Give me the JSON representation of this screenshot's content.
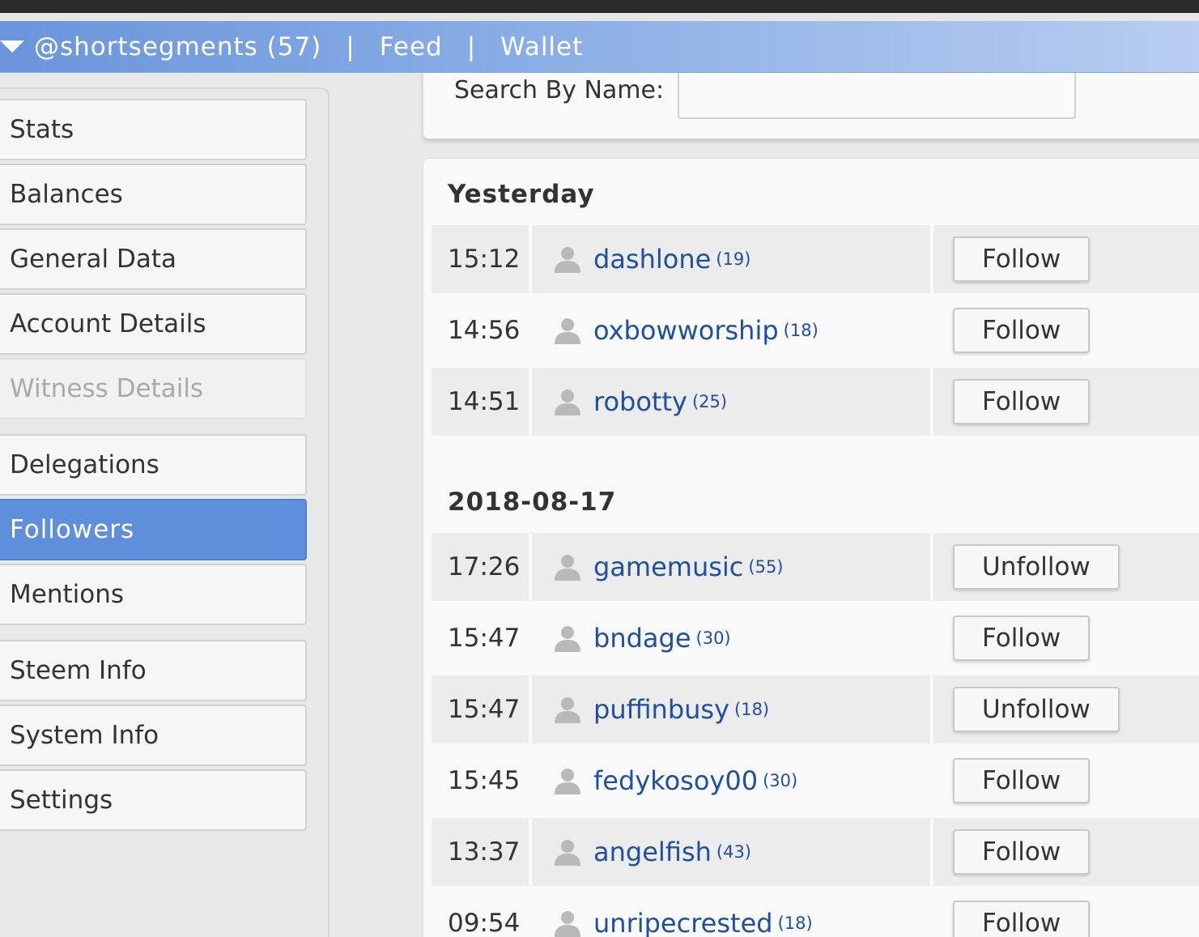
{
  "header": {
    "account": "@shortsegments (57)",
    "separator": "|",
    "feed": "Feed",
    "wallet": "Wallet"
  },
  "sidebar": {
    "items": [
      {
        "label": "Stats",
        "state": "normal"
      },
      {
        "label": "Balances",
        "state": "normal"
      },
      {
        "label": "General Data",
        "state": "normal"
      },
      {
        "label": "Account Details",
        "state": "normal"
      },
      {
        "label": "Witness Details",
        "state": "disabled"
      },
      {
        "label": "Delegations",
        "state": "normal"
      },
      {
        "label": "Followers",
        "state": "active"
      },
      {
        "label": "Mentions",
        "state": "normal"
      },
      {
        "label": "Steem Info",
        "state": "normal"
      },
      {
        "label": "System Info",
        "state": "normal"
      },
      {
        "label": "Settings",
        "state": "normal"
      }
    ]
  },
  "search": {
    "label": "Search By Name:",
    "value": ""
  },
  "groups": [
    {
      "date": "Yesterday",
      "rows": [
        {
          "time": "15:12",
          "name": "dashlone",
          "rep": "(19)",
          "action": "Follow"
        },
        {
          "time": "14:56",
          "name": "oxbowworship",
          "rep": "(18)",
          "action": "Follow"
        },
        {
          "time": "14:51",
          "name": "robotty",
          "rep": "(25)",
          "action": "Follow"
        }
      ]
    },
    {
      "date": "2018-08-17",
      "rows": [
        {
          "time": "17:26",
          "name": "gamemusic",
          "rep": "(55)",
          "action": "Unfollow"
        },
        {
          "time": "15:47",
          "name": "bndage",
          "rep": "(30)",
          "action": "Follow"
        },
        {
          "time": "15:47",
          "name": "puffinbusy",
          "rep": "(18)",
          "action": "Unfollow"
        },
        {
          "time": "15:45",
          "name": "fedykosoy00",
          "rep": "(30)",
          "action": "Follow"
        },
        {
          "time": "13:37",
          "name": "angelfish",
          "rep": "(43)",
          "action": "Follow"
        },
        {
          "time": "09:54",
          "name": "unripecrested",
          "rep": "(18)",
          "action": "Follow"
        }
      ]
    }
  ],
  "colors": {
    "accent": "#5f8fdb",
    "link": "#1e4fa0"
  }
}
